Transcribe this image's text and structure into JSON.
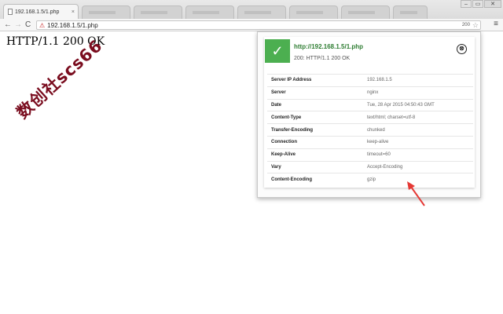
{
  "browser": {
    "active_tab": {
      "title": "192.168.1.5/1.php",
      "close": "×"
    },
    "window_controls": {
      "minimize": "–",
      "restore": "▭",
      "close": "✕"
    },
    "nav": {
      "back": "←",
      "forward": "→",
      "reload": "C"
    },
    "address_bar": {
      "url": "192.168.1.5/1.php",
      "status_code": "200"
    },
    "menu_icon": "≡",
    "star_icon": "☆",
    "lock_icon": "⚠"
  },
  "page": {
    "status_line": "HTTP/1.1 200 OK",
    "watermark": "数创社scs66"
  },
  "popup": {
    "check_icon": "✓",
    "url": "http://192.168.1.5/1.php",
    "status": "200: HTTP/1.1 200 OK",
    "close_icon": "⊗",
    "headers": [
      {
        "name": "Server IP Address",
        "value": "192.168.1.5"
      },
      {
        "name": "Server",
        "value": "nginx"
      },
      {
        "name": "Date",
        "value": "Tue, 28 Apr 2015 04:50:43 GMT"
      },
      {
        "name": "Content-Type",
        "value": "text/html; charset=utf-8"
      },
      {
        "name": "Transfer-Encoding",
        "value": "chunked"
      },
      {
        "name": "Connection",
        "value": "keep-alive"
      },
      {
        "name": "Keep-Alive",
        "value": "timeout=60"
      },
      {
        "name": "Vary",
        "value": "Accept-Encoding"
      },
      {
        "name": "Content-Encoding",
        "value": "gzip"
      }
    ]
  },
  "colors": {
    "accent_green": "#4caf50",
    "url_green": "#2e7d32",
    "watermark": "#7a0d1f",
    "annotation_arrow": "#e53935"
  }
}
